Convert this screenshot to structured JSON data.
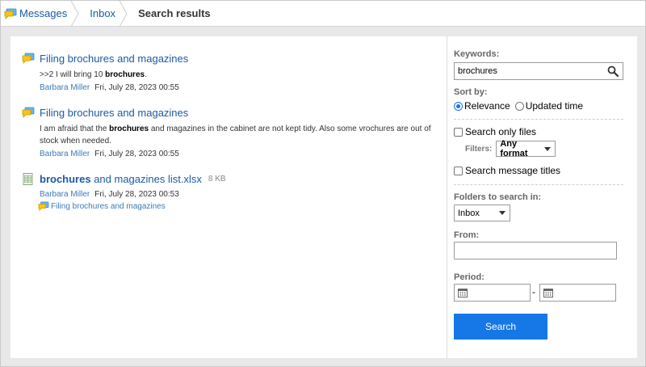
{
  "breadcrumb": {
    "items": [
      "Messages",
      "Inbox"
    ],
    "current": "Search results"
  },
  "results": [
    {
      "type": "message",
      "title": "Filing brochures and magazines",
      "snippet_pre": ">>2 I will bring 10 ",
      "snippet_bold": "brochures",
      "snippet_post": ".",
      "author": "Barbara Miller",
      "date": "Fri, July 28, 2023 00:55"
    },
    {
      "type": "message",
      "title": "Filing brochures and magazines",
      "snippet_pre": "I am afraid that the ",
      "snippet_bold": "brochures",
      "snippet_post": " and magazines in the cabinet are not kept tidy. Also some vrochures are out of stock when needed.",
      "author": "Barbara Miller",
      "date": "Fri, July 28, 2023 00:55"
    },
    {
      "type": "file",
      "title_bold": "brochures",
      "title_rest": " and magazines list.xlsx",
      "size": "8 KB",
      "author": "Barbara Miller",
      "date": "Fri, July 28, 2023 00:53",
      "parent": "Filing brochures and magazines"
    }
  ],
  "search_panel": {
    "keywords_label": "Keywords:",
    "keywords_value": "brochures",
    "sort_label": "Sort by:",
    "sort_options": [
      "Relevance",
      "Updated time"
    ],
    "sort_selected": "Relevance",
    "files_only_label": "Search only files",
    "filters_label": "Filters:",
    "filters_value": "Any format",
    "titles_only_label": "Search message titles",
    "folders_label": "Folders to search in:",
    "folder_value": "Inbox",
    "from_label": "From:",
    "from_value": "",
    "period_label": "Period:",
    "period_separator": "-",
    "search_button": "Search"
  },
  "colors": {
    "link": "#1a5aa6",
    "accent": "#1578e6",
    "muted_label": "#666666"
  }
}
